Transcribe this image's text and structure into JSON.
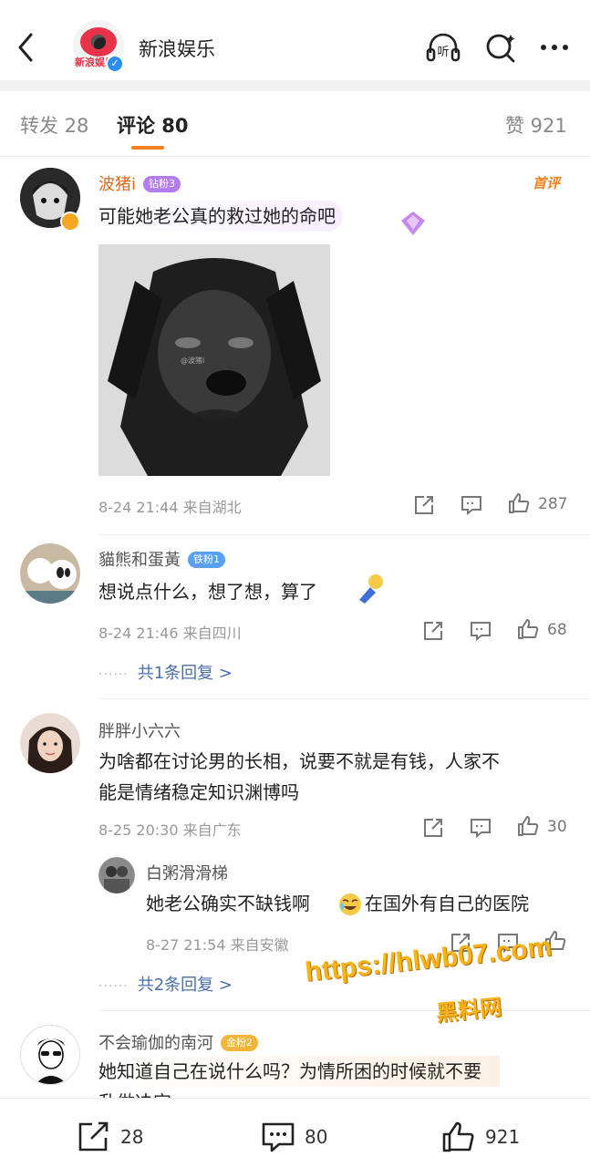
{
  "header": {
    "title": "新浪娱乐",
    "logo_text": "新浪娱乐",
    "listen_label": "听"
  },
  "tabs": [
    {
      "label": "转发 28"
    },
    {
      "label": "评论 80"
    },
    {
      "label": "赞 921"
    }
  ],
  "comments": [
    {
      "name": "波猪i",
      "badge": "钻粉3",
      "tag": "首评",
      "text": "可能她老公真的救过她的命吧",
      "image_watermark": "@波猪i",
      "meta": "8-24 21:44 来自湖北",
      "likes": "287"
    },
    {
      "name": "貓熊和蛋黃",
      "badge": "铁粉1",
      "text": "想说点什么，想了想，算了",
      "meta": "8-24 21:46 来自四川",
      "likes": "68",
      "reply_more": "共1条回复 >"
    },
    {
      "name": "胖胖小六六",
      "text_line1": "为啥都在讨论男的长相，说要不就是有钱，人家不",
      "text_line2": "能是情绪稳定知识渊博吗",
      "meta": "8-25 20:30 来自广东",
      "likes": "30",
      "sub_reply": {
        "name": "白粥滑滑梯",
        "text_a": "她老公确实不缺钱啊",
        "text_b": "在国外有自己的医院",
        "meta": "8-27 21:54 来自安徽"
      },
      "reply_more": "共2条回复 >"
    },
    {
      "name": "不会瑜伽的南河",
      "badge": "金粉2",
      "text_line1": "她知道自己在说什么吗？为情所困的时候就不要",
      "text_line2": "乱做决定"
    }
  ],
  "bottom_bar": {
    "repost": "28",
    "comment": "80",
    "like": "921"
  },
  "watermark": {
    "url": "https://hlwb07.com",
    "sub": "黑料网"
  },
  "colors": {
    "accent": "#f5801f",
    "name_orange": "#e06a1b",
    "link_blue": "#4a6ea8"
  }
}
